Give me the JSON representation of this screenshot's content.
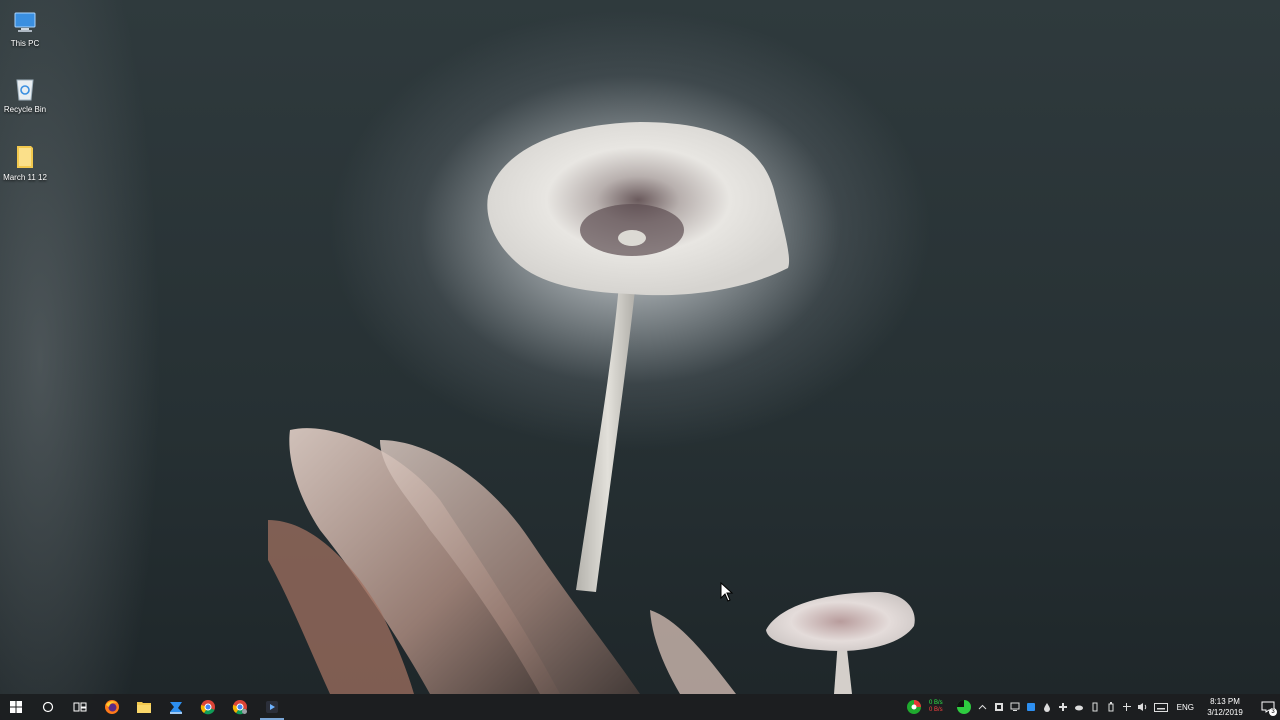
{
  "desktop": {
    "icons": [
      {
        "label": "This PC",
        "icon": "this-pc-icon"
      },
      {
        "label": "Recycle Bin",
        "icon": "recycle-bin-icon"
      },
      {
        "label": "March 11 12",
        "icon": "folder-icon"
      }
    ]
  },
  "taskbar": {
    "apps": [
      {
        "name": "start-button",
        "icon": "windows-logo-icon"
      },
      {
        "name": "cortana-button",
        "icon": "search-circle-icon"
      },
      {
        "name": "task-view-button",
        "icon": "task-view-icon"
      },
      {
        "name": "firefox-button",
        "icon": "firefox-icon"
      },
      {
        "name": "file-explorer-button",
        "icon": "folder-icon"
      },
      {
        "name": "app-blue-button",
        "icon": "blue-app-icon"
      },
      {
        "name": "chrome-button",
        "icon": "chrome-icon"
      },
      {
        "name": "chrome-canary-button",
        "icon": "chrome-alt-icon"
      },
      {
        "name": "active-app-button",
        "icon": "media-app-icon"
      }
    ],
    "tray": {
      "net_up": "0 B/s",
      "net_down": "0 B/s",
      "language": "ENG",
      "time": "8:13 PM",
      "date": "3/12/2019",
      "notification_count": "3"
    }
  },
  "colors": {
    "taskbar_bg": "#1c1e20",
    "accent": "#7aa6d6"
  }
}
